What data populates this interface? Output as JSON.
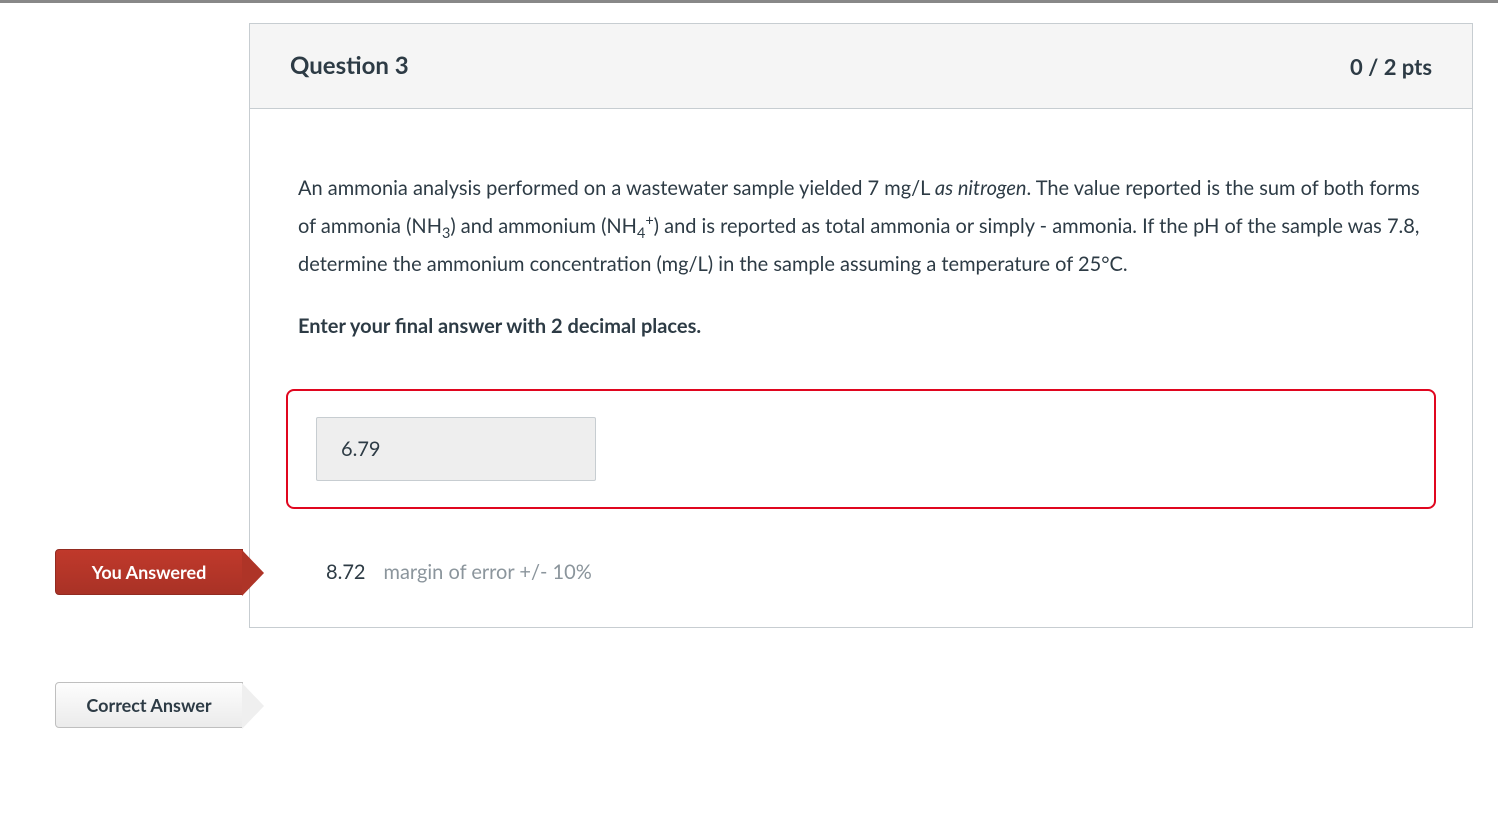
{
  "question": {
    "title": "Question 3",
    "points": "0 / 2 pts",
    "text_part1": "An ammonia analysis performed on a wastewater sample yielded 7 mg/L ",
    "text_italic": "as nitrogen",
    "text_part2": ". The value reported is the sum of both forms of ammonia (NH",
    "text_part3": ") and ammonium (NH",
    "text_part4": ") and is reported as total ammonia or simply - ammonia. If the pH of the sample was 7.8, determine the ammonium concentration (mg/L) in the sample assuming a temperature of 25°C.",
    "instruction": "Enter your final answer with 2 decimal places."
  },
  "tags": {
    "you_answered": "You Answered",
    "correct_answer": "Correct Answer"
  },
  "answers": {
    "user_value": "6.79",
    "correct_value": "8.72",
    "margin": "margin of error +/- 10%"
  }
}
